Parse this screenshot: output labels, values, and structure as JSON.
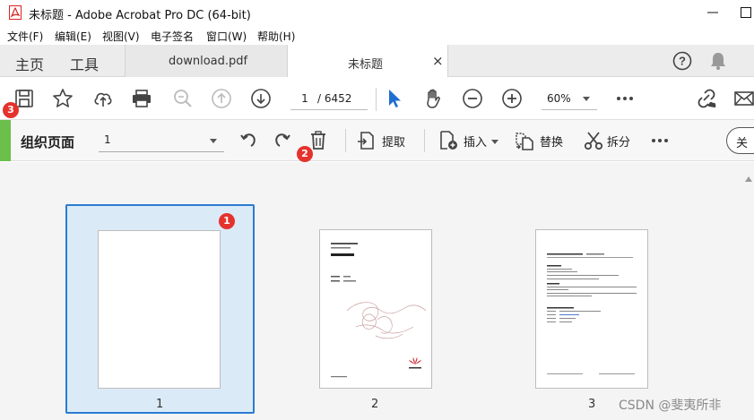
{
  "window": {
    "title": "未标题 - Adobe Acrobat Pro DC (64-bit)"
  },
  "menu": [
    "文件(F)",
    "编辑(E)",
    "视图(V)",
    "电子签名",
    "窗口(W)",
    "帮助(H)"
  ],
  "tabs": {
    "home": "主页",
    "tools": "工具",
    "documents": [
      {
        "label": "download.pdf",
        "active": false
      },
      {
        "label": "未标题",
        "active": true
      }
    ],
    "close_glyph": "×",
    "help_glyph": "?"
  },
  "toolbar": {
    "current_page": "1",
    "total_pages": "/ 6452",
    "zoom": "60%"
  },
  "organize": {
    "title": "组织页面",
    "page_range": "1",
    "extract_label": "提取",
    "insert_label": "插入",
    "replace_label": "替换",
    "split_label": "拆分",
    "close_label": "关"
  },
  "thumbnails": [
    {
      "number": "1",
      "selected": true
    },
    {
      "number": "2",
      "selected": false
    },
    {
      "number": "3",
      "selected": false
    }
  ],
  "badges": {
    "one": "1",
    "two": "2",
    "three": "3"
  },
  "watermark": "CSDN @斐夷所非",
  "colors": {
    "accent_green": "#6bbf4a",
    "select_blue": "#2b7bd1",
    "select_fill": "#dbeaf7",
    "badge_red": "#e5322d",
    "pointer_blue": "#1f6fd0",
    "huawei_red": "#cf1f2e"
  }
}
